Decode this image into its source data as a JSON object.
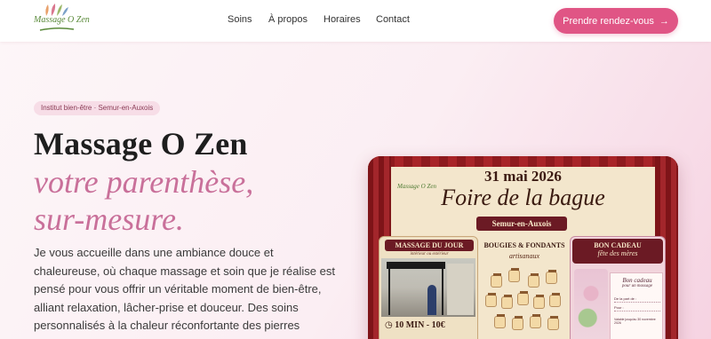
{
  "header": {
    "logo_text": "Massage O Zen",
    "nav": [
      "Soins",
      "À propos",
      "Horaires",
      "Contact"
    ],
    "cta_label": "Prendre rendez-vous",
    "cta_arrow": "→"
  },
  "hero": {
    "badge": "Institut bien-être · Semur-en-Auxois",
    "title": "Massage O Zen",
    "subtitle_line1": "votre parenthèse,",
    "subtitle_line2": "sur-mesure.",
    "description": "Je vous accueille dans une ambiance douce et chaleureuse, où chaque massage et soin que je réalise est pensé pour vous offrir un véritable moment de bien-être, alliant relaxation, lâcher-prise et douceur. Des soins personnalisés à la chaleur réconfortante des pierres chaudes, pour petits et grands, tout est réuni pour vous"
  },
  "poster": {
    "date": "31 mai 2026",
    "logo_text": "Massage O Zen",
    "event": "Foire de la bague",
    "city": "Semur-en-Auxois",
    "massage_title": "MASSAGE DU JOUR",
    "massage_sub": "intérieur ou extérieur",
    "massage_price": "10 MIN - 10€",
    "bougies_title": "BOUGIES & FONDANTS",
    "bougies_sub": "artisanaux",
    "gift_title": "BON CADEAU",
    "gift_sub": "fête des mères",
    "voucher_title": "Bon cadeau",
    "voucher_sub": "pour un massage",
    "voucher_de": "De la part de :",
    "voucher_pour": "Pour :",
    "voucher_note": "Valable jusqu'au 30 novembre 2026"
  },
  "colors": {
    "accent": "#e05585",
    "subtitle": "#c9709a",
    "curtain": "#8e1a1e"
  }
}
